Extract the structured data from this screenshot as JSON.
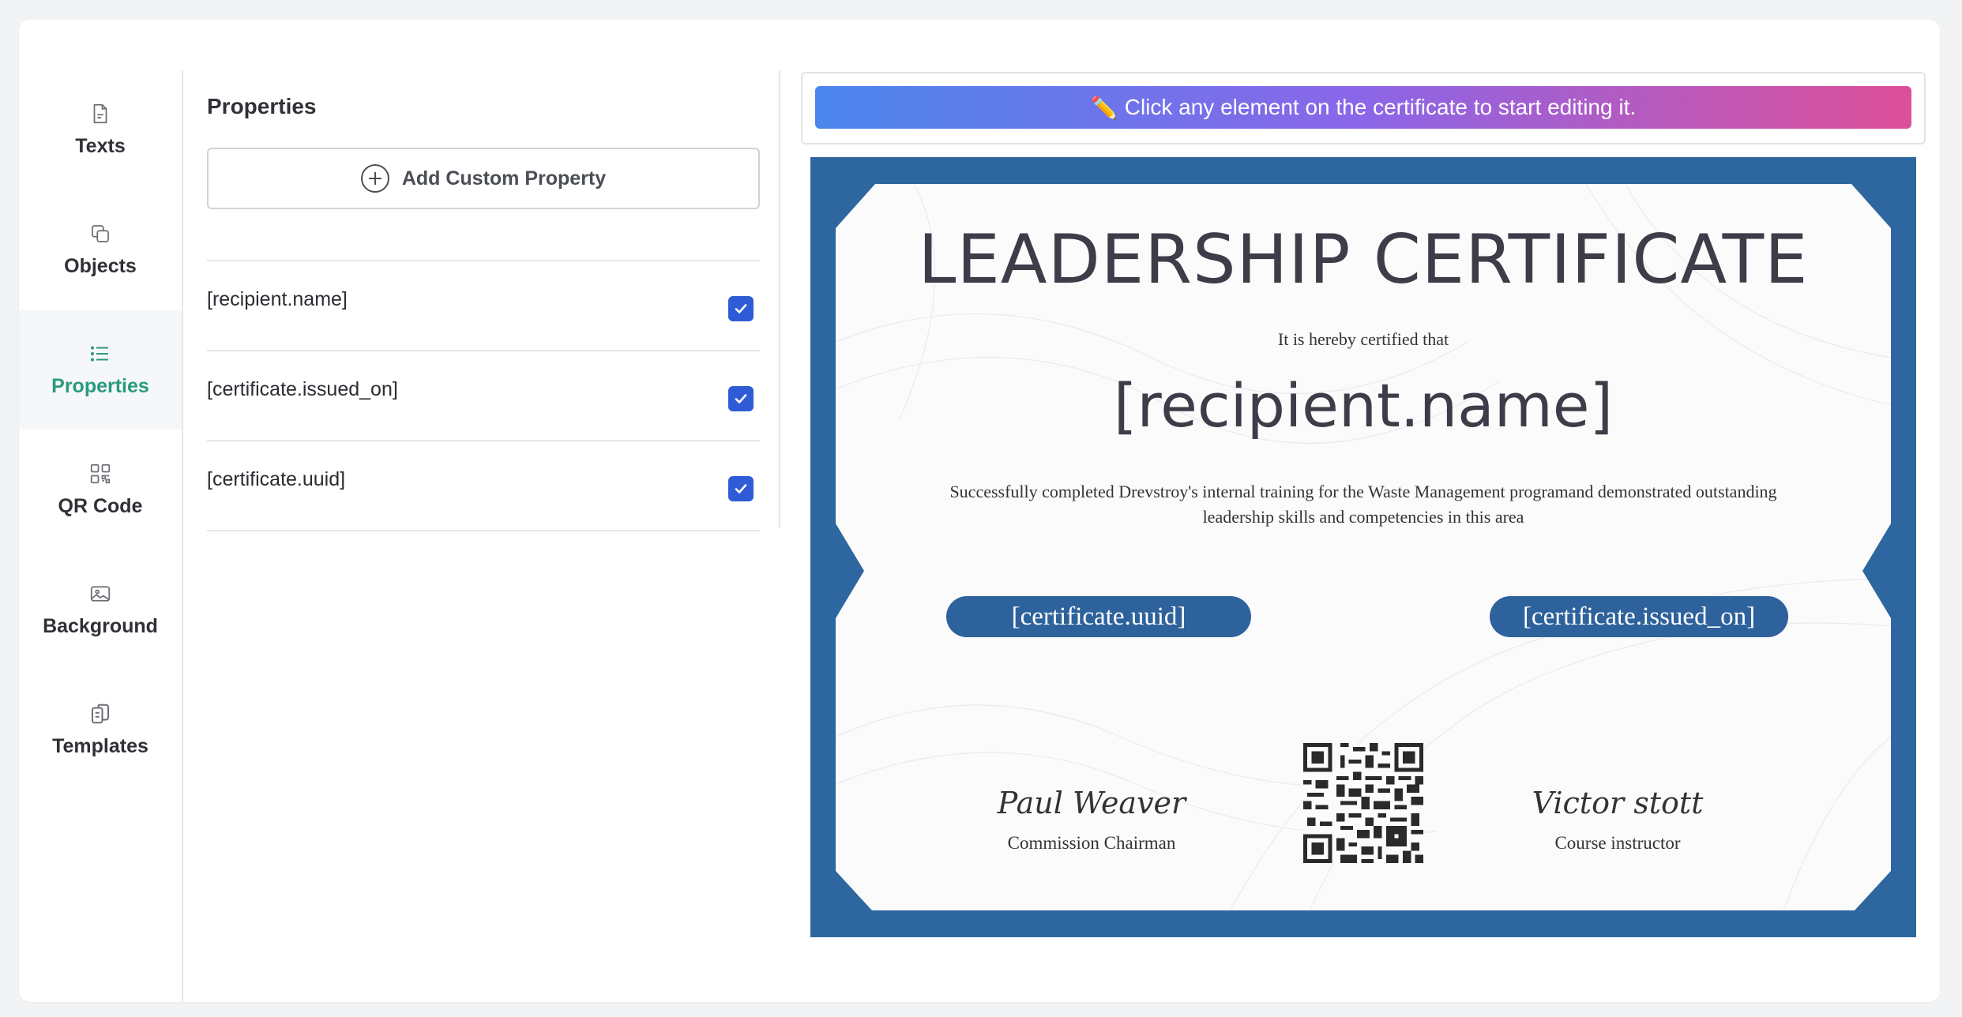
{
  "sidebar": {
    "items": [
      {
        "label": "Texts",
        "icon": "document-icon"
      },
      {
        "label": "Objects",
        "icon": "copy-icon"
      },
      {
        "label": "Properties",
        "icon": "list-icon",
        "active": true
      },
      {
        "label": "QR Code",
        "icon": "qr-code-icon"
      },
      {
        "label": "Background",
        "icon": "image-icon"
      },
      {
        "label": "Templates",
        "icon": "clipboard-copy-icon"
      }
    ],
    "accent_color": "#2b9a7e"
  },
  "properties": {
    "title": "Properties",
    "add_button_label": "Add Custom Property",
    "items": [
      {
        "name": "[recipient.name]",
        "checked": true
      },
      {
        "name": "[certificate.issued_on]",
        "checked": true
      },
      {
        "name": "[certificate.uuid]",
        "checked": true
      }
    ],
    "checkbox_color": "#2f5bd6"
  },
  "hint": {
    "icon": "✏️",
    "text": "Click any element on the certificate to start editing it."
  },
  "certificate": {
    "title": "LEADERSHIP CERTIFICATE",
    "subtitle": "It is hereby certified that",
    "recipient": "[recipient.name]",
    "description": "Successfully completed Drevstroy's internal training for the Waste Management programand demonstrated outstanding leadership skills and competencies in this area",
    "uuid_field": "[certificate.uuid]",
    "issued_field": "[certificate.issued_on]",
    "signer_left": {
      "name": "Paul Weaver",
      "role": "Commission Chairman"
    },
    "signer_right": {
      "name": "Victor stott",
      "role": "Course instructor"
    },
    "frame_color": "#2e679f"
  }
}
